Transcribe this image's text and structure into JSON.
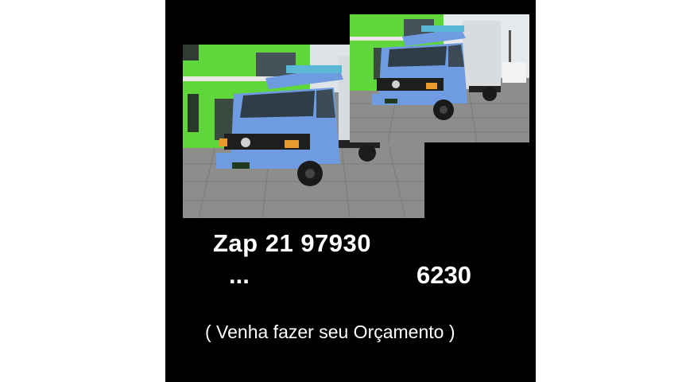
{
  "poster": {
    "phone_prefix": "Zap 21 97930",
    "ellipsis": "...",
    "phone_suffix": "6230",
    "tagline": "( Venha fazer seu Orçamento )"
  },
  "colors": {
    "background": "#000000",
    "text": "#ffffff",
    "truck_blue": "#6f9be0",
    "building_green": "#5fd63a"
  }
}
